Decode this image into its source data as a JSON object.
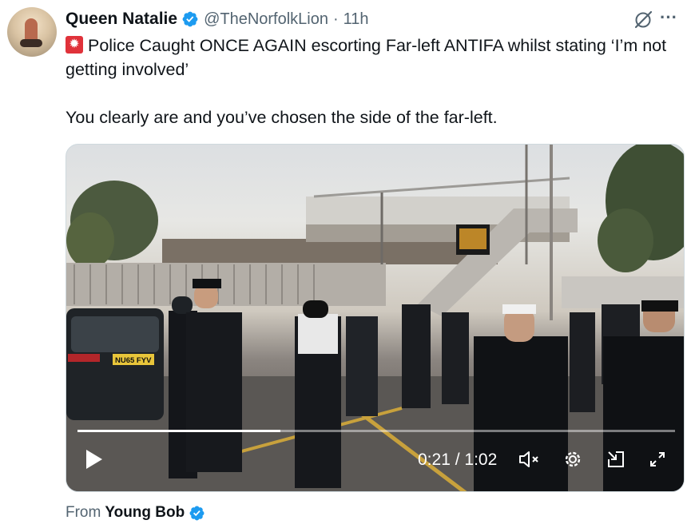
{
  "post": {
    "author_name": "Queen Natalie",
    "handle": "@TheNorfolkLion",
    "separator": "·",
    "time_ago": "11h",
    "text_line1": "Police Caught ONCE AGAIN escorting Far-left ANTIFA whilst stating ‘I’m not getting involved’",
    "text_line2": "You clearly are and you’ve chosen the side of the far-left."
  },
  "video": {
    "current_time": "0:21",
    "time_separator": "/",
    "duration": "1:02",
    "progress_fraction": 0.339,
    "plate_text": "NU65 FYV"
  },
  "attribution": {
    "label": "From",
    "source_name": "Young Bob"
  },
  "icons": {
    "verified": "verified-badge-icon",
    "grok": "grok-icon",
    "more": "more-options-icon",
    "play": "play-icon",
    "mute": "mute-icon",
    "settings": "settings-gear-icon",
    "pip": "picture-in-picture-icon",
    "fullscreen": "fullscreen-icon",
    "siren": "police-light-emoji"
  },
  "colors": {
    "verified_blue": "#1d9bf0",
    "secondary_text": "#536471",
    "primary_text": "#0f1419"
  }
}
